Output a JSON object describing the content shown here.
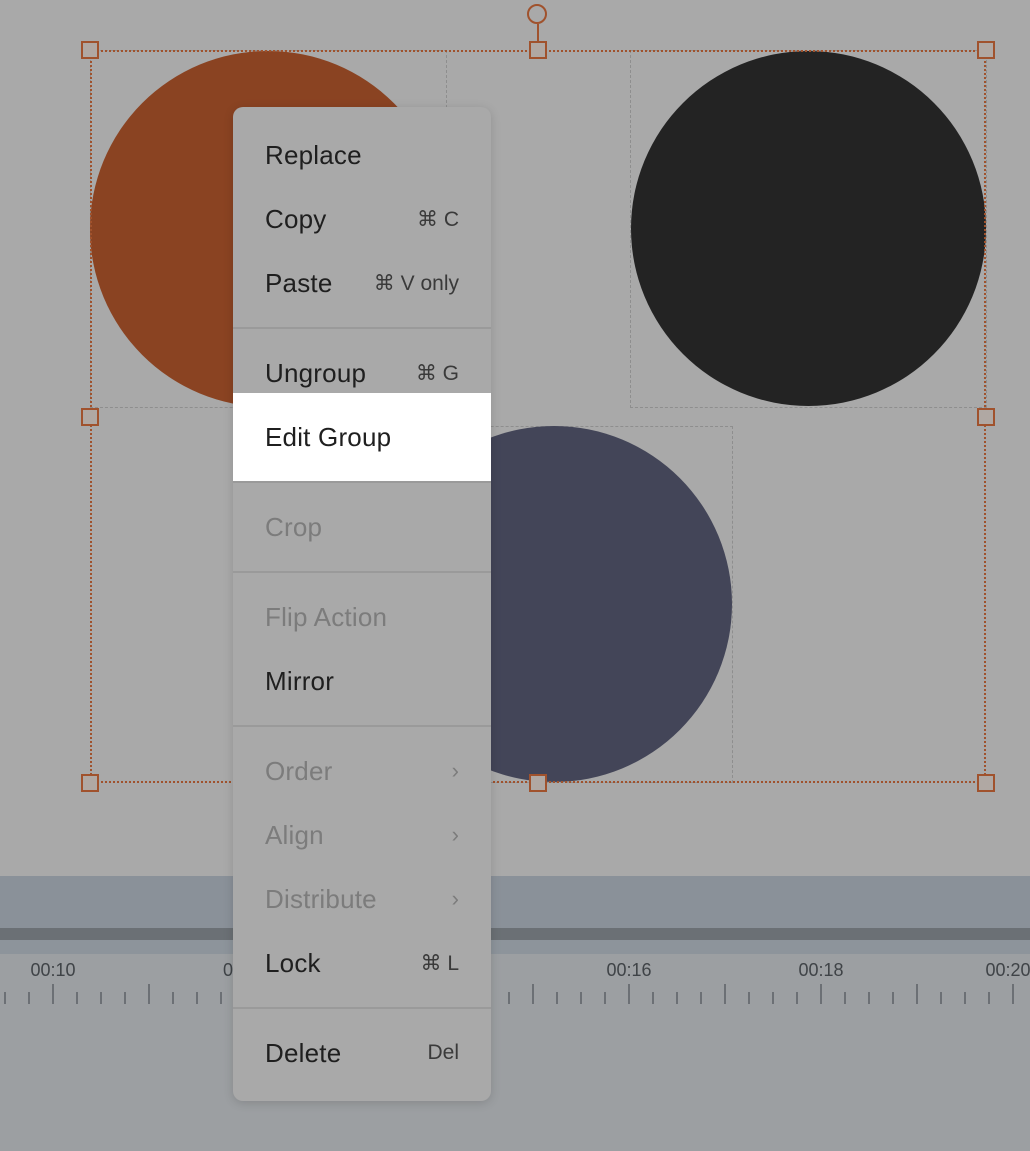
{
  "canvas": {
    "shapes": [
      {
        "name": "orange-circle",
        "color": "#8a4322"
      },
      {
        "name": "black-circle",
        "color": "#232323"
      },
      {
        "name": "navy-circle",
        "color": "#434558"
      }
    ],
    "selection_color": "#a0522d"
  },
  "timeline": {
    "labels": [
      "00:10",
      "0",
      "00:16",
      "00:18",
      "00:20"
    ]
  },
  "context_menu": {
    "items": [
      {
        "label": "Replace",
        "shortcut": ""
      },
      {
        "label": "Copy",
        "shortcut": "⌘ C"
      },
      {
        "label": "Paste",
        "shortcut": "⌘ V only"
      },
      {
        "label": "Ungroup",
        "shortcut": "⌘ G"
      },
      {
        "label": "Edit Group",
        "shortcut": "",
        "highlighted": true
      },
      {
        "label": "Crop",
        "shortcut": "",
        "disabled": true
      },
      {
        "label": "Flip Action",
        "shortcut": "",
        "disabled": true
      },
      {
        "label": "Mirror",
        "shortcut": ""
      },
      {
        "label": "Order",
        "shortcut": "›",
        "disabled": true
      },
      {
        "label": "Align",
        "shortcut": "›",
        "disabled": true
      },
      {
        "label": "Distribute",
        "shortcut": "›",
        "disabled": true
      },
      {
        "label": "Lock",
        "shortcut": "⌘ L"
      },
      {
        "label": "Delete",
        "shortcut": "Del"
      }
    ]
  }
}
